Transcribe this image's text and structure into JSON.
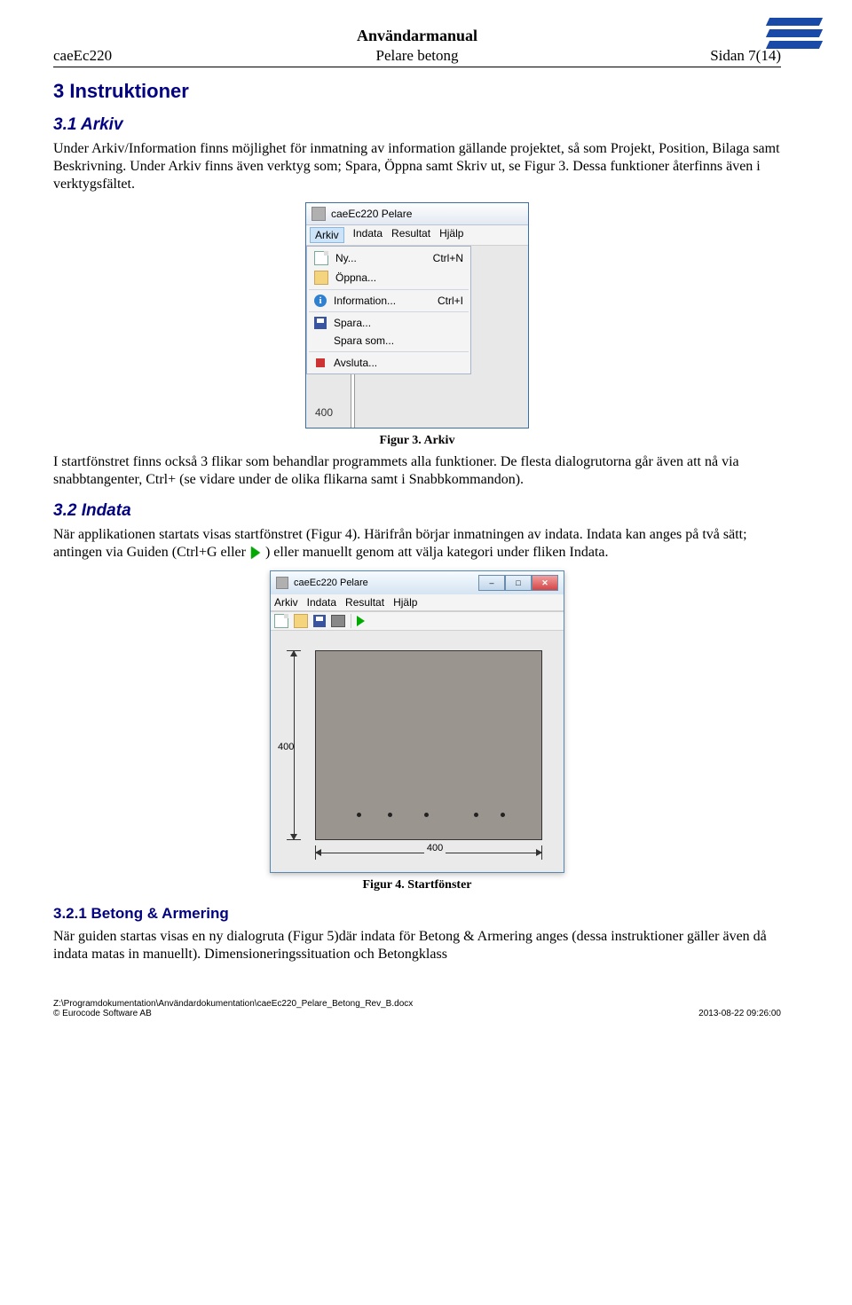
{
  "header": {
    "doc_title": "Användarmanual",
    "left": "caeEc220",
    "center": "Pelare betong",
    "right": "Sidan 7(14)"
  },
  "sec3": {
    "heading": "3   Instruktioner",
    "sec31_heading": "3.1  Arkiv",
    "p1": "Under Arkiv/Information finns möjlighet för inmatning av information gällande projektet, så som Projekt, Position, Bilaga samt Beskrivning. Under Arkiv finns även verktyg som; Spara, Öppna samt Skriv ut, se Figur 3. Dessa funktioner återfinns även i verktygsfältet.",
    "fig3_caption": "Figur 3. Arkiv",
    "p2": "I startfönstret finns också 3 flikar som behandlar programmets alla funktioner. De flesta dialogrutorna går även att nå via snabbtangenter, Ctrl+ (se vidare under de olika flikarna samt i Snabbkommandon).",
    "sec32_heading": "3.2  Indata",
    "p3a": "När applikationen startats visas startfönstret (Figur 4). Härifrån börjar inmatningen av indata. Indata kan anges på två sätt; antingen via Guiden (Ctrl+G eller ",
    "p3b": ") eller manuellt genom att välja kategori under fliken Indata.",
    "fig4_caption": "Figur 4. Startfönster",
    "sec321_heading": "3.2.1 Betong & Armering",
    "p4": "När guiden startas visas en ny dialogruta (Figur 5)där indata för Betong & Armering anges (dessa instruktioner gäller även då indata matas in manuellt). Dimensioneringssituation och Betongklass"
  },
  "shot1": {
    "app_title": "caeEc220 Pelare",
    "menus": [
      "Arkiv",
      "Indata",
      "Resultat",
      "Hjälp"
    ],
    "items": [
      {
        "icon": "new",
        "label": "Ny...",
        "accel": "Ctrl+N"
      },
      {
        "icon": "open",
        "label": "Öppna...",
        "accel": ""
      },
      {
        "sep": true
      },
      {
        "icon": "info",
        "label": "Information...",
        "accel": "Ctrl+I"
      },
      {
        "sep": true
      },
      {
        "icon": "save",
        "label": "Spara...",
        "accel": ""
      },
      {
        "icon": "",
        "label": "Spara som...",
        "accel": ""
      },
      {
        "sep": true
      },
      {
        "icon": "exit",
        "label": "Avsluta...",
        "accel": ""
      }
    ],
    "body_num": "400"
  },
  "shot2": {
    "app_title": "caeEc220 Pelare",
    "menus": [
      "Arkiv",
      "Indata",
      "Resultat",
      "Hjälp"
    ],
    "dim_v": "400",
    "dim_h": "400"
  },
  "footer": {
    "left1": "Z:\\Programdokumentation\\Användardokumentation\\caeEc220_Pelare_Betong_Rev_B.docx",
    "left2": "© Eurocode Software AB",
    "right": "2013-08-22 09:26:00"
  }
}
